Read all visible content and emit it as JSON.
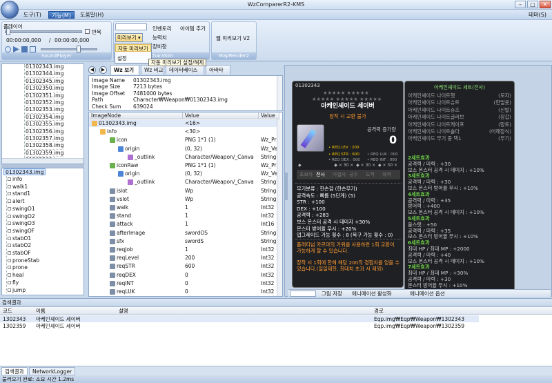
{
  "app": {
    "title": "WzComparerR2-KMS",
    "right_menu": "테마(S)"
  },
  "menu": {
    "tools": "도구(T)",
    "function": "기능(M)",
    "help": "도움말(H)"
  },
  "ribbon": {
    "player_label": "플레이어",
    "repeat": "반복",
    "time1": "00:00:00,000",
    "time2": "00:00:00,000",
    "sound_group": "SoundPlayer",
    "preview": "미리보기",
    "auto_preview": "자동 미리보기",
    "settings": "설정",
    "inventory": "인벤토리",
    "item_add": "아이템 추가",
    "stat": "능력치",
    "equip": "장비창",
    "charasim_group": "CharaSim",
    "webpreview": "웹 미리보기 V2",
    "maprender_group": "MapRender2",
    "tooltip": "자동 미리보기 설정/해제"
  },
  "file_list": [
    "01302343.img",
    "01302344.img",
    "01302345.img",
    "01302350.img",
    "01302351.img",
    "01302352.img",
    "01302353.img",
    "01302354.img",
    "01302355.img",
    "01302356.img",
    "01302357.img",
    "01302358.img",
    "01302359.img",
    "01302360.img"
  ],
  "node_tree": {
    "root": "01302343.img",
    "items": [
      "info",
      "walk1",
      "stand1",
      "alert",
      "swingO1",
      "swingO2",
      "swingO3",
      "swingOF",
      "stabO1",
      "stabO2",
      "stabOF",
      "proneStab",
      "prone",
      "heal",
      "fly",
      "jump"
    ]
  },
  "tabs": [
    "Wz 보기",
    "Wz 비교",
    "데이터베이스",
    "아바타"
  ],
  "info": {
    "rows": [
      [
        "Image Name",
        "01302343.img"
      ],
      [
        "Image Size",
        "7213 bytes"
      ],
      [
        "Image Offset",
        "7481000 bytes"
      ],
      [
        "Path",
        "Character₩Weapon₩01302343.img"
      ],
      [
        "Check Sum",
        "639024"
      ]
    ]
  },
  "grid": {
    "headers": [
      "ImageNode",
      "Value",
      "Value"
    ],
    "rows": [
      [
        "01302343.img",
        "<16>",
        ""
      ],
      [
        "info",
        "<30>",
        ""
      ],
      [
        "icon",
        "PNG 1*1 (1)",
        "Wz_Pr"
      ],
      [
        "origin",
        "(0, 32)",
        "Wz_Ve"
      ],
      [
        "_outlink",
        "Character/Weapon/_Canva",
        "String"
      ],
      [
        "iconRaw",
        "PNG 1*1 (1)",
        "Wz_Pr"
      ],
      [
        "origin",
        "(0, 32)",
        "Wz_Ve"
      ],
      [
        "_outlink",
        "Character/Weapon/_Canva",
        "String"
      ],
      [
        "islot",
        "Wp",
        "String"
      ],
      [
        "vslot",
        "Wp",
        "String"
      ],
      [
        "walk",
        "1",
        "Int32"
      ],
      [
        "stand",
        "1",
        "Int32"
      ],
      [
        "attack",
        "1",
        "Int16"
      ],
      [
        "afterImage",
        "swordOS",
        "String"
      ],
      [
        "sfx",
        "swordS",
        "String"
      ],
      [
        "reqJob",
        "1",
        "Int32"
      ],
      [
        "reqLevel",
        "200",
        "Int32"
      ],
      [
        "reqSTR",
        "600",
        "Int32"
      ],
      [
        "reqDEX",
        "0",
        "Int32"
      ],
      [
        "reqINT",
        "0",
        "Int32"
      ],
      [
        "reqLUK",
        "0",
        "Int32"
      ]
    ]
  },
  "tooltip_item": {
    "code": "01302343",
    "stars": "★★★★★ ★★★★★",
    "stars2": "★★★★★ ★★★★★ ★★★★★",
    "name": "아케인셰이드 세이버",
    "sub": "장착 시 교환 불가",
    "inc_label": "공격력 증가량",
    "inc_value": "0",
    "req_lev": "• REQ LEV : 200",
    "req_str": "• REQ STR : 600",
    "req_luk": "• REQ LUK : 000",
    "req_dex": "• REQ DEX : 000",
    "req_int": "• REQ INT : 000",
    "jobs": [
      "초보자",
      "전사",
      "마법사",
      "궁수",
      "도적",
      "해적"
    ],
    "stats": [
      "무기분류 : 한손검 (한손무기)",
      "공격속도 : 빠름 (5단계) (5)",
      "STR : +100",
      "DEX : +100",
      "공격력 : +283",
      "보스 몬스터 공격 시 데미지 +30%",
      "몬스터 방어율 무시 : +20%",
      "업그레이드 가능 횟수 : 8 (복구 가능 횟수 : 0)"
    ],
    "desc1": "플래티넘 카르마의 가위를 사용하면 1회 교환이 가능하게 할 수 있습니다.",
    "desc2": "장착 시 1회에 한해 해당 200의 경험치를 얻을 수 있습니다.(일일제한, 최대치 초과 시 제외)"
  },
  "tooltip_set": {
    "title": "아케인셰이드 세트(전사)",
    "items": [
      [
        "아케인셰이드 나이트햇",
        "(모자)"
      ],
      [
        "아케인셰이드 나이트슈트",
        "(한벌옷)"
      ],
      [
        "아케인셰이드 나이트슈즈",
        "(신발)"
      ],
      [
        "아케인셰이드 나이트글러브",
        "(장갑)"
      ],
      [
        "아케인셰이드 나이트케이프",
        "(망토)"
      ],
      [
        "아케인셰이드 나이트숄더",
        "(어깨장식)"
      ],
      [
        "아케인셰이드 무기 중 택1",
        "(무기)"
      ]
    ],
    "effects": [
      [
        "2세트효과",
        ""
      ],
      [
        "공격력 / 마력 : +30",
        ""
      ],
      [
        "보스 몬스터 공격 시 데미지 : +10%",
        ""
      ],
      [
        "3세트효과",
        ""
      ],
      [
        "공격력 / 마력 : +30",
        ""
      ],
      [
        "보스 몬스터 방어율 무시 : +10%",
        ""
      ],
      [
        "4세트효과",
        ""
      ],
      [
        "공격력 / 마력 : +35",
        ""
      ],
      [
        "방어력 : +400",
        ""
      ],
      [
        "보스 몬스터 공격 시 데미지 : +10%",
        ""
      ],
      [
        "5세트효과",
        ""
      ],
      [
        "올스탯 : +50",
        ""
      ],
      [
        "공격력 / 마력 : +35",
        ""
      ],
      [
        "보스 몬스터 방어율 무시 : +10%",
        ""
      ],
      [
        "6세트효과",
        ""
      ],
      [
        "최대 HP / 최대 MP : +2000",
        ""
      ],
      [
        "공격력 / 마력 : +40",
        ""
      ],
      [
        "보스 몬스터 공격 시 데미지 : +10%",
        ""
      ],
      [
        "7세트효과",
        ""
      ],
      [
        "최대 HP / 최대 MP : +30%",
        ""
      ],
      [
        "공격력 / 마력 : +30",
        ""
      ],
      [
        "몬스터 방어율 무시 : +10%",
        ""
      ]
    ]
  },
  "bottom_toolbar": {
    "save": "그림 저장",
    "anim_active": "애니메이션 활성화",
    "anim_options": "애니메이션 옵션"
  },
  "search": {
    "title": "검색결과",
    "cols": [
      "코드",
      "이름",
      "설명",
      "경로"
    ],
    "rows": [
      [
        "1302343",
        "아케인셰이드 세이버",
        "",
        "Eqp.img₩Eqp₩Weapon₩1302343"
      ],
      [
        "1302359",
        "아케인셰이드 세이버",
        "",
        "Eqp.img₩Eqp₩Weapon₩1302359"
      ]
    ]
  },
  "bottom_tabs": [
    "검색결과",
    "NetworkLogger"
  ],
  "status": "불러오기 완료: 소요 시간 1.2ms",
  "colors": {
    "accent": "#2f63b1",
    "set_title": "#8fe37a",
    "tt_gold": "#ffcc00",
    "tt_orange": "#ff9b33",
    "set_green": "#6fd34a"
  }
}
